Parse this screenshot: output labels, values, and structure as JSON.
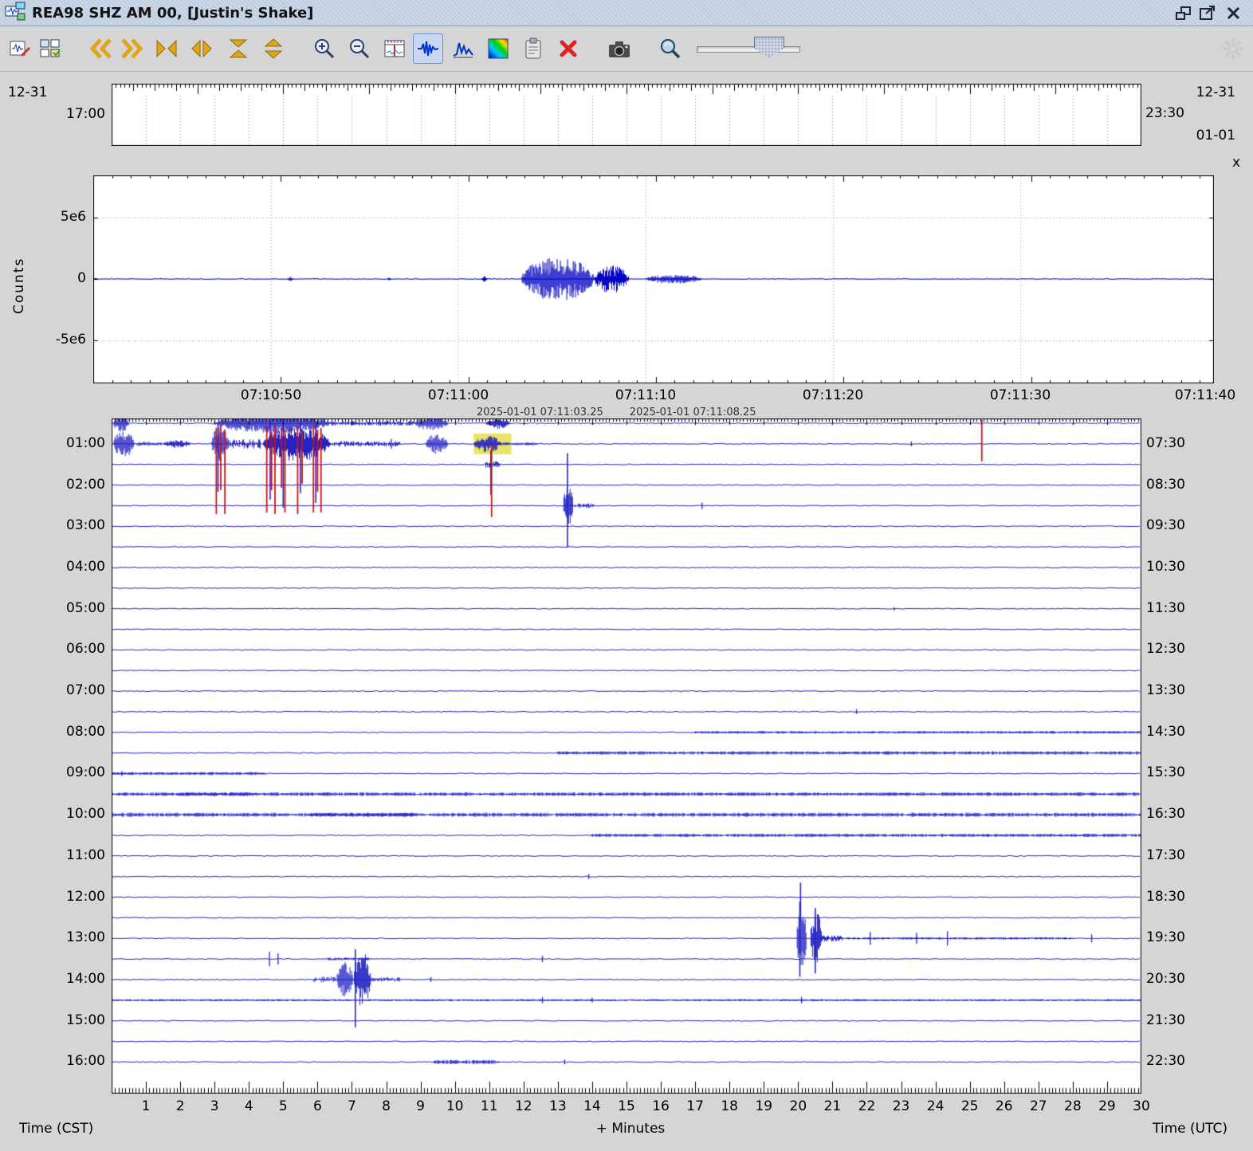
{
  "window": {
    "title": "REA98 SHZ AM 00, [Justin's Shake]"
  },
  "toolbar": {
    "icons": [
      "open-file-icon",
      "save-layout-icon",
      "scroll-back-icon",
      "scroll-forward-icon",
      "compress-time-icon",
      "expand-time-icon",
      "compress-amplitude-icon",
      "expand-amplitude-icon",
      "zoom-in-icon",
      "zoom-out-icon",
      "time-settings-icon",
      "waveform-view-icon",
      "spectra-view-icon",
      "spectrogram-view-icon",
      "clipboard-icon",
      "remove-view-icon",
      "capture-image-icon",
      "search-icon",
      "duration-slider",
      "throbber-icon"
    ],
    "selected_tool": "waveform-view"
  },
  "overview": {
    "left_date": "12-31",
    "left_time": "17:00",
    "right_date": "12-31",
    "right_time": "23:30",
    "right_date2": "01-01"
  },
  "zoom_panel": {
    "ylabel": "Counts",
    "yticks": [
      "5e6",
      "0",
      "-5e6"
    ],
    "xticks": [
      "07:10:50",
      "07:11:00",
      "07:11:10",
      "07:11:20",
      "07:11:30",
      "07:11:40"
    ],
    "close_label": "x",
    "status_text": "2025-01-01 07:11:03.25        2025-01-01 07:11:08.25"
  },
  "helicorder": {
    "left_labels": [
      "01:00",
      "02:00",
      "03:00",
      "04:00",
      "05:00",
      "06:00",
      "07:00",
      "08:00",
      "09:00",
      "10:00",
      "11:00",
      "12:00",
      "13:00",
      "14:00",
      "15:00",
      "16:00"
    ],
    "right_labels": [
      "07:30",
      "08:30",
      "09:30",
      "10:30",
      "11:30",
      "12:30",
      "13:30",
      "14:30",
      "15:30",
      "16:30",
      "17:30",
      "18:30",
      "19:30",
      "20:30",
      "21:30",
      "22:30"
    ],
    "minute_labels": [
      "1",
      "2",
      "3",
      "4",
      "5",
      "6",
      "7",
      "8",
      "9",
      "10",
      "11",
      "12",
      "13",
      "14",
      "15",
      "16",
      "17",
      "18",
      "19",
      "20",
      "21",
      "22",
      "23",
      "24",
      "25",
      "26",
      "27",
      "28",
      "29",
      "30"
    ],
    "xlabel": "+ Minutes",
    "footer_left": "Time (CST)",
    "footer_right": "Time (UTC)"
  },
  "colors": {
    "trace": "#2323c3",
    "zoom_trace": "#0000c4",
    "clip": "#cc1212",
    "selection": "#e9e468",
    "gold": "#dfa61c"
  },
  "chart_data": [
    {
      "id": "zoom",
      "type": "line",
      "ylabel": "Counts",
      "ytick_labels": [
        "5e6",
        "0",
        "-5e6"
      ],
      "ytick_values": [
        5000000,
        0,
        -5000000
      ],
      "xtick_labels": [
        "07:10:50",
        "07:11:00",
        "07:11:10",
        "07:11:20",
        "07:11:30",
        "07:11:40"
      ],
      "baseline": 0,
      "events": [
        {
          "kind": "blip",
          "t": 0.176,
          "w": 0.003,
          "amp": 250000
        },
        {
          "kind": "blip",
          "t": 0.264,
          "w": 0.002,
          "amp": 150000
        },
        {
          "kind": "blip",
          "t": 0.349,
          "w": 0.003,
          "amp": 300000
        },
        {
          "kind": "burst",
          "t0": 0.382,
          "t1": 0.447,
          "amp": 1800000
        },
        {
          "kind": "burst",
          "t0": 0.447,
          "t1": 0.478,
          "amp": 1150000
        },
        {
          "kind": "burst",
          "t0": 0.493,
          "t1": 0.543,
          "amp": 380000
        }
      ]
    },
    {
      "id": "helicorder",
      "type": "helicorder",
      "lines": 32,
      "minutes_per_line": 30,
      "selection": {
        "line": 1,
        "m0": 10.55,
        "m1": 11.65
      },
      "events": [
        {
          "line": 0,
          "kind": "burst",
          "m0": 0.05,
          "m1": 0.5,
          "amp": 12
        },
        {
          "line": 0,
          "kind": "burst",
          "m0": 3.0,
          "m1": 6.4,
          "amp": 13
        },
        {
          "line": 0,
          "kind": "noise",
          "m0": 6.4,
          "m1": 8.8,
          "amp": 3
        },
        {
          "line": 0,
          "kind": "burst",
          "m0": 8.8,
          "m1": 9.8,
          "amp": 9
        },
        {
          "line": 0,
          "kind": "burst",
          "m0": 10.9,
          "m1": 11.6,
          "amp": 7
        },
        {
          "line": 1,
          "kind": "burst",
          "m0": 0.05,
          "m1": 0.65,
          "amp": 18
        },
        {
          "line": 1,
          "kind": "noise",
          "m0": 0.65,
          "m1": 1.45,
          "amp": 2.5
        },
        {
          "line": 1,
          "kind": "burst",
          "m0": 1.5,
          "m1": 2.3,
          "amp": 5
        },
        {
          "line": 1,
          "kind": "burst",
          "m0": 2.9,
          "m1": 3.4,
          "amp": 22
        },
        {
          "line": 1,
          "kind": "noise",
          "m0": 3.4,
          "m1": 4.35,
          "amp": 6
        },
        {
          "line": 1,
          "kind": "burst",
          "m0": 4.4,
          "m1": 6.4,
          "amp": 22
        },
        {
          "line": 1,
          "kind": "noise",
          "m0": 6.4,
          "m1": 8.4,
          "amp": 3.5
        },
        {
          "line": 1,
          "kind": "spike",
          "m0": 8.15,
          "amp": 6
        },
        {
          "line": 1,
          "kind": "burst",
          "m0": 9.15,
          "m1": 9.8,
          "amp": 13
        },
        {
          "line": 1,
          "kind": "burst",
          "m0": 10.55,
          "m1": 11.35,
          "amp": 11
        },
        {
          "line": 1,
          "kind": "noise",
          "m0": 11.35,
          "m1": 12.4,
          "amp": 2
        },
        {
          "line": 1,
          "kind": "spike",
          "m0": 23.3,
          "amp": 3
        },
        {
          "line": 2,
          "kind": "noise",
          "m0": 10.9,
          "m1": 11.3,
          "amp": 4
        },
        {
          "line": 2,
          "kind": "spike",
          "m0": 11.05,
          "amp": 10
        },
        {
          "line": 4,
          "kind": "burst",
          "m0": 13.15,
          "m1": 13.45,
          "amp": 26
        },
        {
          "line": 4,
          "kind": "noise",
          "m0": 13.45,
          "m1": 14.05,
          "amp": 3
        },
        {
          "line": 4,
          "kind": "spike",
          "m0": 17.2,
          "amp": 4
        },
        {
          "line": 9,
          "kind": "spike",
          "m0": 22.8,
          "amp": 2
        },
        {
          "line": 14,
          "kind": "spike",
          "m0": 21.7,
          "amp": 3
        },
        {
          "line": 15,
          "kind": "dashes",
          "m0": 17,
          "m1": 30,
          "amp": 1.4
        },
        {
          "line": 16,
          "kind": "dashes",
          "m0": 13,
          "m1": 30,
          "amp": 1.8
        },
        {
          "line": 17,
          "kind": "dashes",
          "m0": 0,
          "m1": 4.5,
          "amp": 1.6
        },
        {
          "line": 17,
          "kind": "spike",
          "m0": 0.3,
          "amp": 3
        },
        {
          "line": 18,
          "kind": "dashes",
          "m0": 0,
          "m1": 30,
          "amp": 2.0
        },
        {
          "line": 18,
          "kind": "noise",
          "m0": 1.9,
          "m1": 4.2,
          "amp": 2.5
        },
        {
          "line": 19,
          "kind": "dashes",
          "m0": 0,
          "m1": 30,
          "amp": 2.2
        },
        {
          "line": 19,
          "kind": "noise",
          "m0": 5.8,
          "m1": 8.8,
          "amp": 2.5
        },
        {
          "line": 20,
          "kind": "dashes",
          "m0": 14,
          "m1": 30,
          "amp": 1.8
        },
        {
          "line": 22,
          "kind": "spike",
          "m0": 13.9,
          "amp": 3
        },
        {
          "line": 25,
          "kind": "burst",
          "m0": 19.95,
          "m1": 20.25,
          "amp": 38
        },
        {
          "line": 25,
          "kind": "burst",
          "m0": 20.35,
          "m1": 20.7,
          "amp": 34
        },
        {
          "line": 25,
          "kind": "noise",
          "m0": 20.7,
          "m1": 21.3,
          "amp": 4
        },
        {
          "line": 25,
          "kind": "dashes",
          "m0": 21.3,
          "m1": 28,
          "amp": 1.2
        },
        {
          "line": 25,
          "kind": "spike",
          "m0": 22.1,
          "amp": 8
        },
        {
          "line": 25,
          "kind": "spike",
          "m0": 23.45,
          "amp": 7
        },
        {
          "line": 25,
          "kind": "spike",
          "m0": 24.35,
          "amp": 9
        },
        {
          "line": 25,
          "kind": "spike",
          "m0": 28.55,
          "amp": 5
        },
        {
          "line": 26,
          "kind": "spike",
          "m0": 4.6,
          "amp": 9
        },
        {
          "line": 26,
          "kind": "spike",
          "m0": 4.85,
          "amp": 7
        },
        {
          "line": 26,
          "kind": "noise",
          "m0": 6.3,
          "m1": 7.6,
          "amp": 2
        },
        {
          "line": 26,
          "kind": "spike",
          "m0": 12.55,
          "amp": 4
        },
        {
          "line": 27,
          "kind": "noise",
          "m0": 5.9,
          "m1": 6.55,
          "amp": 4
        },
        {
          "line": 27,
          "kind": "burst",
          "m0": 6.55,
          "m1": 7.05,
          "amp": 22
        },
        {
          "line": 27,
          "kind": "burst",
          "m0": 7.05,
          "m1": 7.55,
          "amp": 40
        },
        {
          "line": 27,
          "kind": "noise",
          "m0": 7.55,
          "m1": 8.4,
          "amp": 3
        },
        {
          "line": 27,
          "kind": "spike",
          "m0": 9.3,
          "amp": 3
        },
        {
          "line": 28,
          "kind": "dashes",
          "m0": 0,
          "m1": 30,
          "amp": 1.1
        },
        {
          "line": 28,
          "kind": "spike",
          "m0": 12.55,
          "amp": 4
        },
        {
          "line": 28,
          "kind": "spike",
          "m0": 14.0,
          "amp": 3
        },
        {
          "line": 28,
          "kind": "spike",
          "m0": 20.1,
          "amp": 4
        },
        {
          "line": 31,
          "kind": "dashes",
          "m0": 9.4,
          "m1": 11.3,
          "amp": 2.2
        },
        {
          "line": 31,
          "kind": "spike",
          "m0": 13.2,
          "amp": 3
        }
      ],
      "vlines": [
        {
          "line": 1,
          "m": 3.1,
          "u": 25,
          "d": 60
        },
        {
          "line": 1,
          "m": 4.62,
          "u": 28,
          "d": 70
        },
        {
          "line": 1,
          "m": 5.0,
          "u": 25,
          "d": 80
        },
        {
          "line": 1,
          "m": 5.5,
          "u": 28,
          "d": 62
        },
        {
          "line": 1,
          "m": 5.95,
          "u": 25,
          "d": 74
        },
        {
          "line": 2,
          "m": 11.05,
          "u": 18,
          "d": 38
        },
        {
          "line": 4,
          "m": 13.28,
          "u": 66,
          "d": 52
        },
        {
          "line": 24,
          "m": 20.07,
          "u": 44,
          "d": 4
        },
        {
          "line": 25,
          "m": 20.05,
          "u": 46,
          "d": 48
        },
        {
          "line": 25,
          "m": 20.5,
          "u": 38,
          "d": 44
        },
        {
          "line": 27,
          "m": 7.1,
          "u": 38,
          "d": 60
        }
      ],
      "redlines": [
        {
          "line": 1,
          "m": 3.05,
          "u": 20,
          "d": 88
        },
        {
          "line": 1,
          "m": 3.18,
          "u": 24,
          "d": 58
        },
        {
          "line": 1,
          "m": 3.3,
          "u": 18,
          "d": 88
        },
        {
          "line": 1,
          "m": 4.52,
          "u": 22,
          "d": 86
        },
        {
          "line": 1,
          "m": 4.66,
          "u": 15,
          "d": 58
        },
        {
          "line": 1,
          "m": 4.76,
          "u": 24,
          "d": 88
        },
        {
          "line": 1,
          "m": 4.95,
          "u": 20,
          "d": 55
        },
        {
          "line": 1,
          "m": 5.05,
          "u": 18,
          "d": 86
        },
        {
          "line": 1,
          "m": 5.42,
          "u": 22,
          "d": 88
        },
        {
          "line": 1,
          "m": 5.55,
          "u": 15,
          "d": 50
        },
        {
          "line": 1,
          "m": 5.88,
          "u": 24,
          "d": 86
        },
        {
          "line": 1,
          "m": 6.0,
          "u": 18,
          "d": 60
        },
        {
          "line": 1,
          "m": 6.1,
          "u": 20,
          "d": 86
        },
        {
          "line": 1,
          "m": 25.35,
          "u": 30,
          "d": 22
        },
        {
          "line": 2,
          "m": 11.07,
          "u": 24,
          "d": 66
        }
      ]
    }
  ]
}
